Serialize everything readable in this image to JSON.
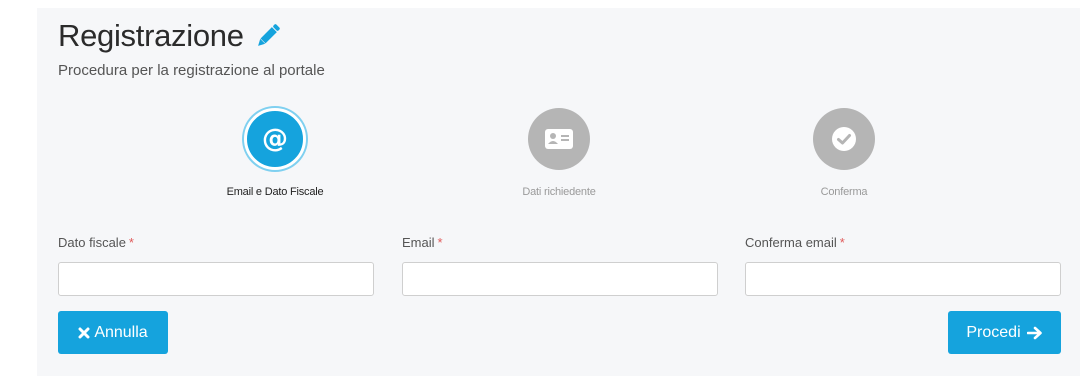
{
  "header": {
    "title": "Registrazione",
    "subtitle": "Procedura per la registrazione al portale"
  },
  "steps": [
    {
      "label": "Email e Dato Fiscale",
      "icon": "at-icon",
      "state": "active"
    },
    {
      "label": "Dati richiedente",
      "icon": "id-card-icon",
      "state": "inactive"
    },
    {
      "label": "Conferma",
      "icon": "check-icon",
      "state": "inactive"
    }
  ],
  "form": {
    "fields": [
      {
        "label": "Dato fiscale",
        "required_mark": "*",
        "value": ""
      },
      {
        "label": "Email",
        "required_mark": "*",
        "value": ""
      },
      {
        "label": "Conferma email",
        "required_mark": "*",
        "value": ""
      }
    ]
  },
  "actions": {
    "cancel_label": "Annulla",
    "proceed_label": "Procedi"
  },
  "colors": {
    "accent": "#15a3dd",
    "inactive_step": "#b5b5b5",
    "required": "#e05a5a",
    "panel_background": "#f6f7f9"
  }
}
